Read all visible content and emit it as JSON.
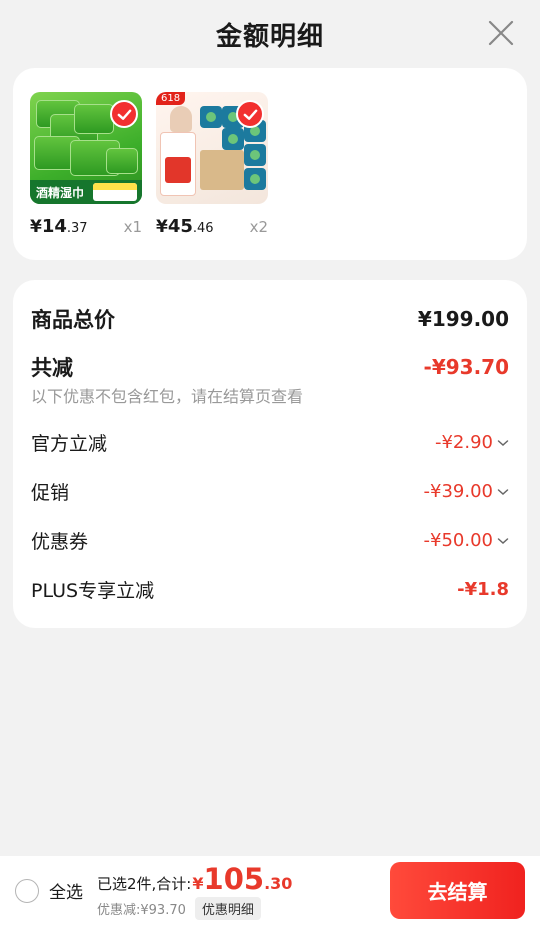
{
  "header": {
    "title": "金额明细",
    "close_icon": "close-icon"
  },
  "goods": [
    {
      "image_text": "酒精湿巾",
      "currency": "¥",
      "price_int": "14",
      "price_dec": ".37",
      "qty": "x1",
      "selected": true
    },
    {
      "image_badge": "618",
      "currency": "¥",
      "price_int": "45",
      "price_dec": ".46",
      "qty": "x2",
      "selected": true
    }
  ],
  "summary": {
    "total_label": "商品总价",
    "total_value": "¥199.00",
    "reduce_label": "共减",
    "reduce_value": "-¥93.70",
    "hint": "以下优惠不包含红包，请在结算页查看",
    "items": [
      {
        "label": "官方立减",
        "value": "-¥2.90",
        "expandable": true
      },
      {
        "label": "促销",
        "value": "-¥39.00",
        "expandable": true
      },
      {
        "label": "优惠券",
        "value": "-¥50.00",
        "expandable": true
      },
      {
        "label": "PLUS专享立减",
        "value": "-¥1.8",
        "expandable": false
      }
    ]
  },
  "bottom": {
    "select_all": "全选",
    "selected_count": "已选2件,合计:",
    "currency": "¥",
    "amount_int": "105",
    "amount_dec": ".30",
    "saved": "优惠减:¥93.70",
    "detail_button": "优惠明细",
    "checkout_button": "去结算"
  },
  "colors": {
    "accent": "#e8392b",
    "button": "#f0221f",
    "check": "#f23030"
  }
}
